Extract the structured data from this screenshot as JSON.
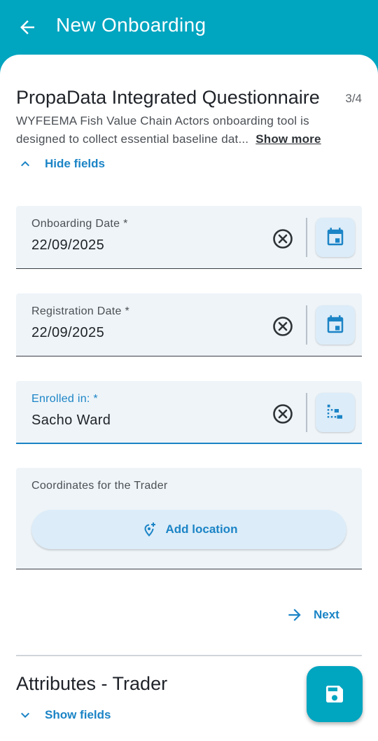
{
  "appbar": {
    "title": "New Onboarding",
    "back_icon": "arrow-back-icon"
  },
  "section": {
    "title": "PropaData Integrated Questionnaire",
    "page_count": "3/4",
    "description": "WYFEEMA Fish Value Chain Actors onboarding tool is designed to collect essential baseline dat...",
    "show_more_label": "Show more",
    "hide_fields_label": "Hide fields"
  },
  "fields": [
    {
      "label": "Onboarding Date *",
      "value": "22/09/2025",
      "action_icon": "calendar-icon"
    },
    {
      "label": "Registration Date *",
      "value": "22/09/2025",
      "action_icon": "calendar-icon"
    },
    {
      "label": "Enrolled in: *",
      "value": "Sacho Ward",
      "action_icon": "org-tree-icon"
    }
  ],
  "coordinates": {
    "label": "Coordinates for the Trader",
    "button_label": "Add location"
  },
  "next_label": "Next",
  "attributes": {
    "title": "Attributes - Trader",
    "show_fields_label": "Show fields"
  },
  "colors": {
    "primary": "#00a5c0",
    "accent": "#1b84c6",
    "field_bg": "#eef4f8"
  }
}
